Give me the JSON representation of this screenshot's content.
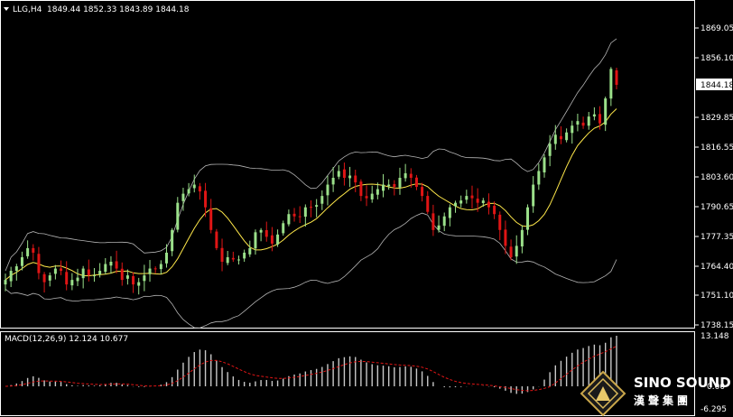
{
  "header": {
    "symbol_timeframe": "LLG,H4",
    "ohlc": "1849.44 1852.33 1843.89 1844.18"
  },
  "price_axis": {
    "ticks": [
      "1869.05",
      "1856.10",
      "1844.18",
      "1829.85",
      "1816.55",
      "1803.60",
      "1790.65",
      "1777.35",
      "1764.40",
      "1751.10",
      "1738.15"
    ],
    "current_price": "1844.18"
  },
  "macd_panel": {
    "label": "MACD(12,26,9) 12.124 10.677",
    "ticks": [
      "13.148",
      "0.00",
      "-6.295"
    ]
  },
  "watermark": {
    "line1": "SINO SOUND",
    "line2": "漢聲集團"
  },
  "colors": {
    "background": "#000000",
    "bull_candle": "#9be08a",
    "bear_candle": "#e01515",
    "bollinger": "#b4b4b4",
    "moving_average": "#ffe84a",
    "macd_hist": "#c8c8c8",
    "macd_signal": "#e01515"
  },
  "chart_data": {
    "type": "candlestick",
    "series_overlays": [
      "bollinger-bands",
      "moving-average"
    ],
    "ylim": [
      1738.15,
      1869.05
    ],
    "close": [
      1758,
      1762,
      1764,
      1768,
      1772,
      1770,
      1761,
      1757,
      1760,
      1763,
      1762,
      1756,
      1758,
      1759,
      1763,
      1760,
      1760,
      1762,
      1765,
      1766,
      1763,
      1758,
      1760,
      1756,
      1757,
      1760,
      1763,
      1763,
      1765,
      1770,
      1780,
      1792,
      1796,
      1798,
      1800,
      1797,
      1790,
      1780,
      1772,
      1766,
      1768,
      1767,
      1767,
      1770,
      1772,
      1779,
      1780,
      1777,
      1774,
      1778,
      1783,
      1787,
      1786,
      1786,
      1790,
      1790,
      1791,
      1795,
      1800,
      1803,
      1806,
      1803,
      1804,
      1801,
      1795,
      1794,
      1796,
      1798,
      1800,
      1800,
      1799,
      1803,
      1805,
      1803,
      1799,
      1795,
      1788,
      1780,
      1782,
      1786,
      1790,
      1792,
      1793,
      1795,
      1794,
      1792,
      1793,
      1790,
      1787,
      1780,
      1773,
      1768,
      1773,
      1780,
      1790,
      1800,
      1806,
      1812,
      1818,
      1822,
      1820,
      1823,
      1826,
      1828,
      1826,
      1830,
      1831,
      1827,
      1838,
      1851,
      1844
    ]
  }
}
